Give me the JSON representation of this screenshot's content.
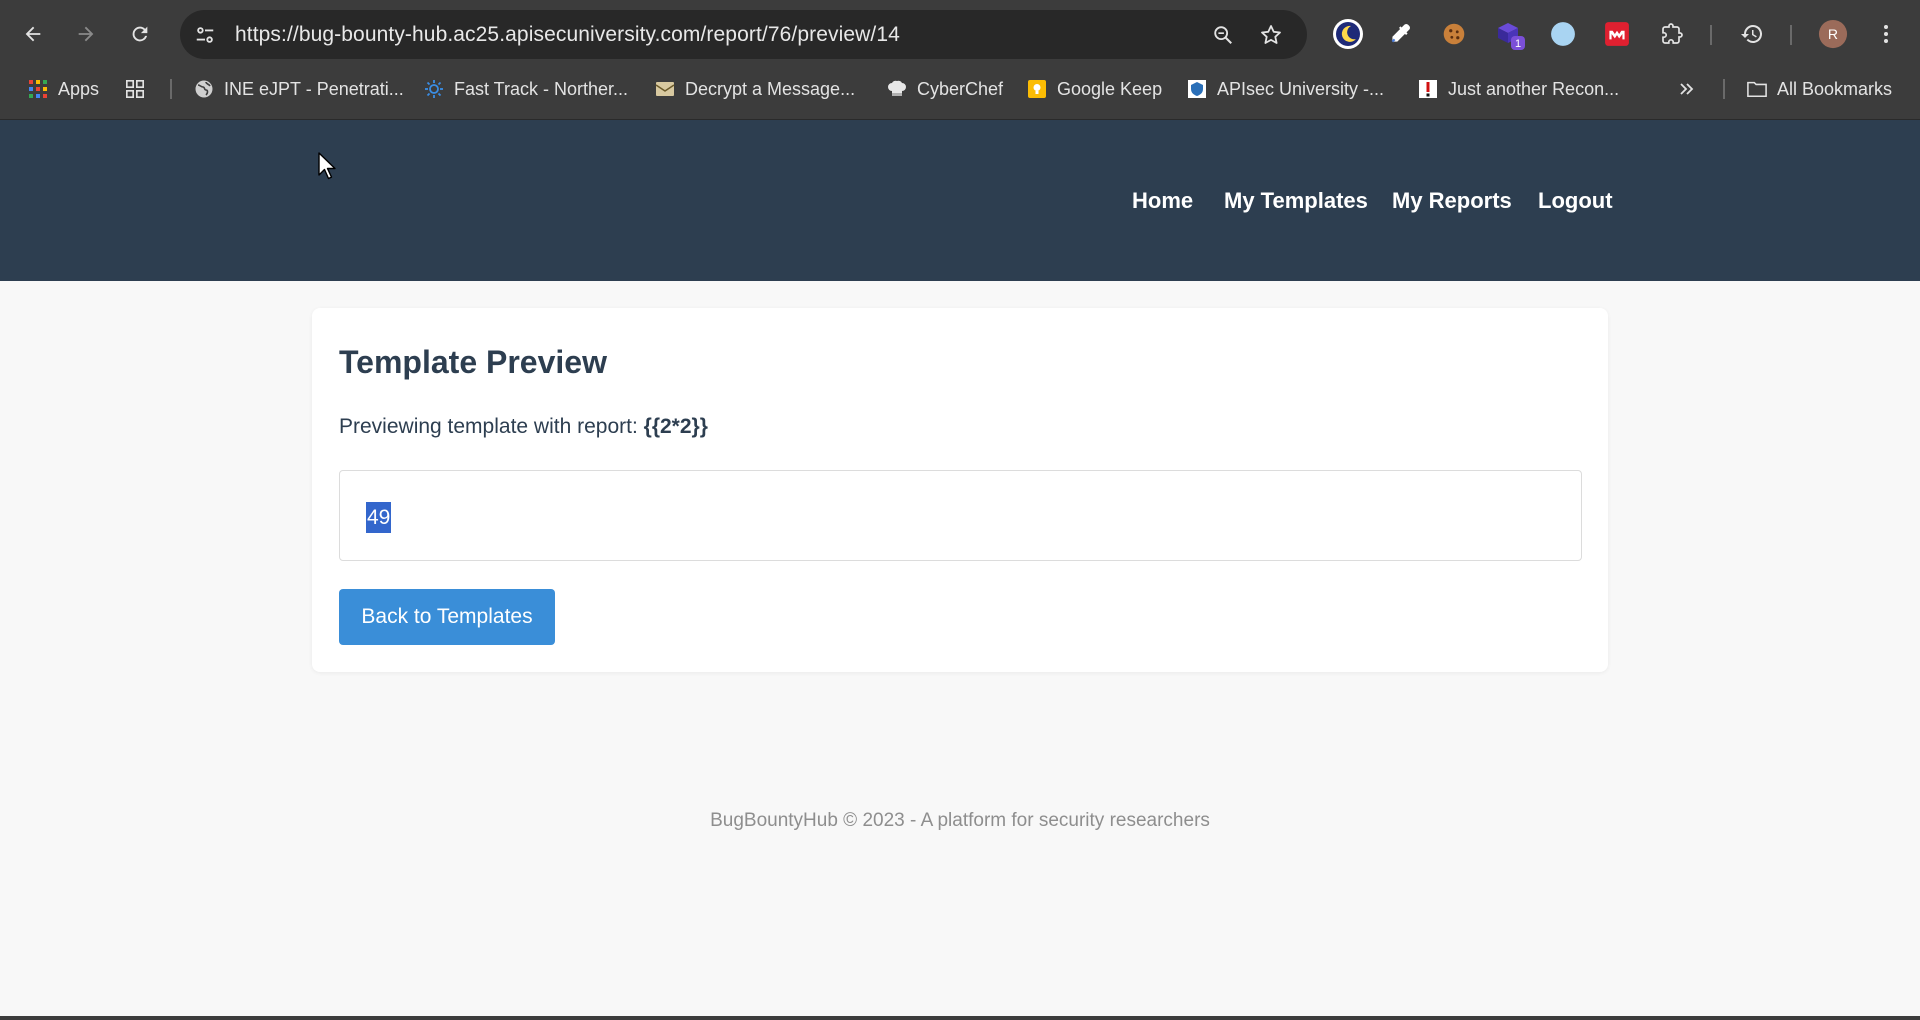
{
  "browser": {
    "url": "https://bug-bounty-hub.ac25.apisecuniversity.com/report/76/preview/14",
    "extension_badge": "1",
    "profile_initial": "R"
  },
  "bookmarks": {
    "apps_label": "Apps",
    "items": [
      {
        "label": "INE eJPT - Penetrati..."
      },
      {
        "label": "Fast Track - Norther..."
      },
      {
        "label": "Decrypt a Message..."
      },
      {
        "label": "CyberChef"
      },
      {
        "label": "Google Keep"
      },
      {
        "label": "APIsec University -..."
      },
      {
        "label": "Just another Recon..."
      }
    ],
    "all_bookmarks_label": "All Bookmarks"
  },
  "site": {
    "nav": {
      "home": "Home",
      "my_templates": "My Templates",
      "my_reports": "My Reports",
      "logout": "Logout"
    }
  },
  "card": {
    "title": "Template Preview",
    "desc_prefix": "Previewing template with report: ",
    "report_name": "{{2*2}}",
    "preview_value": "49",
    "back_button": "Back to Templates"
  },
  "footer": {
    "text": "BugBountyHub © 2023 - A platform for security researchers"
  }
}
